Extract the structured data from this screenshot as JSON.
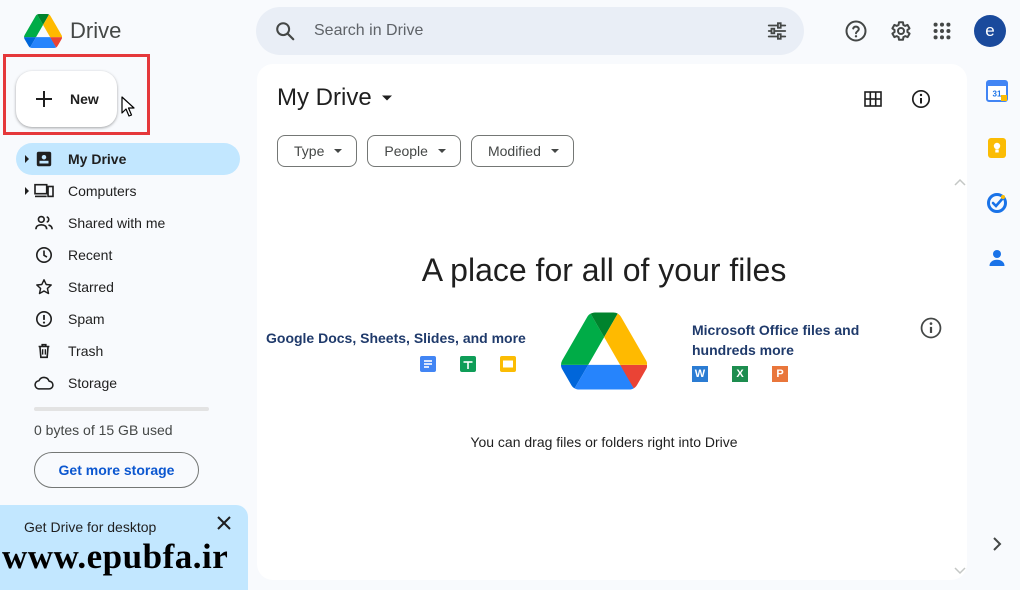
{
  "header": {
    "app_title": "Drive",
    "search_placeholder": "Search in Drive",
    "avatar_letter": "e"
  },
  "new_button": {
    "label": "New"
  },
  "sidebar": {
    "items": [
      {
        "label": "My Drive",
        "icon": "my-drive-icon",
        "active": true
      },
      {
        "label": "Computers",
        "icon": "computers-icon"
      },
      {
        "label": "Shared with me",
        "icon": "shared-icon"
      },
      {
        "label": "Recent",
        "icon": "clock-icon"
      },
      {
        "label": "Starred",
        "icon": "star-icon"
      },
      {
        "label": "Spam",
        "icon": "spam-icon"
      },
      {
        "label": "Trash",
        "icon": "trash-icon"
      },
      {
        "label": "Storage",
        "icon": "cloud-icon"
      }
    ],
    "storage_used_fraction": 0,
    "storage_text": "0 bytes of 15 GB used",
    "storage_button": "Get more storage"
  },
  "promo": {
    "title": "Get Drive for desktop"
  },
  "watermark": "www.epubfa.ir",
  "main": {
    "title": "My Drive",
    "filters": [
      "Type",
      "People",
      "Modified"
    ],
    "empty_title": "A place for all of your files",
    "left_caption": "Google Docs, Sheets, Slides, and more",
    "right_caption": "Microsoft Office files and hundreds more",
    "office_badges": [
      "W",
      "X",
      "P"
    ],
    "drag_hint": "You can drag files or folders right into Drive"
  },
  "rail": {
    "calendar_day": "31"
  },
  "colors": {
    "accent": "#0b57d0",
    "active_nav": "#c2e7ff",
    "highlight_box": "#e5383b",
    "google_blue": "#4285f4",
    "google_green": "#0f9d58",
    "google_yellow": "#fbbc04",
    "google_red": "#ea4335"
  }
}
